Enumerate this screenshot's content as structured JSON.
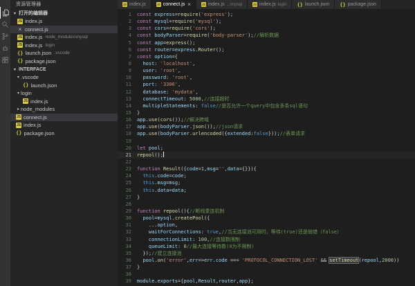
{
  "tab_close_glyph": "×",
  "activity_bar": [
    {
      "name": "explorer",
      "icon": "files",
      "active": true
    },
    {
      "name": "search",
      "icon": "search",
      "active": false
    },
    {
      "name": "source-control",
      "icon": "git",
      "active": false
    },
    {
      "name": "debug",
      "icon": "debug",
      "active": false
    },
    {
      "name": "extensions",
      "icon": "extensions",
      "active": false
    }
  ],
  "sidebar": {
    "title": "资源管理器",
    "open_editors": {
      "header": "打开的编辑器",
      "items": [
        {
          "label": "index.js",
          "icon": "js"
        },
        {
          "label": "connect.js",
          "icon": "close",
          "active": true
        },
        {
          "label": "index.js",
          "icon": "js",
          "desc": "node_modules\\mysql"
        },
        {
          "label": "index.js",
          "icon": "js",
          "desc": "login"
        },
        {
          "label": "launch.json",
          "icon": "json",
          "desc": ".vscode"
        },
        {
          "label": "package.json",
          "icon": "json"
        }
      ]
    },
    "tree": {
      "header": "INTERFACE",
      "items": [
        {
          "label": ".vscode",
          "icon": "none",
          "chevron": "down",
          "indent": 0
        },
        {
          "label": "launch.json",
          "icon": "json",
          "indent": 1
        },
        {
          "label": "login",
          "icon": "none",
          "chevron": "down",
          "indent": 0
        },
        {
          "label": "index.js",
          "icon": "js",
          "indent": 1
        },
        {
          "label": "node_modules",
          "icon": "none",
          "chevron": "right",
          "indent": 0
        },
        {
          "label": "connect.js",
          "icon": "js",
          "indent": 0,
          "active": true
        },
        {
          "label": "index.js",
          "icon": "js",
          "indent": 0
        },
        {
          "label": "package.json",
          "icon": "json",
          "indent": 0
        }
      ]
    }
  },
  "tabs": [
    {
      "label": "index.js",
      "icon": "js"
    },
    {
      "label": "connect.js",
      "icon": "js",
      "active": true
    },
    {
      "label": "index.js",
      "icon": "js",
      "desc": "...\\mysql"
    },
    {
      "label": "index.js",
      "icon": "js",
      "desc": "login"
    },
    {
      "label": "launch.json",
      "icon": "json"
    },
    {
      "label": "package.json",
      "icon": "json"
    }
  ],
  "editor": {
    "cursor_line": 21,
    "colors": {
      "background": "#1e1e1e",
      "keyword": "#c586c0",
      "keyword2": "#569cd6",
      "variable": "#9cdcfe",
      "function": "#dcdcaa",
      "string": "#ce9178",
      "number": "#b5cea8",
      "comment": "#6a9955",
      "default": "#d4d4d4"
    },
    "lines": [
      [
        [
          "k",
          "const "
        ],
        [
          "v",
          "express"
        ],
        [
          "w",
          "="
        ],
        [
          "f",
          "require"
        ],
        [
          "w",
          "("
        ],
        [
          "s",
          "'express'"
        ],
        [
          "w",
          ");"
        ]
      ],
      [
        [
          "k",
          "const "
        ],
        [
          "v",
          "mysql"
        ],
        [
          "w",
          "="
        ],
        [
          "f",
          "require"
        ],
        [
          "w",
          "("
        ],
        [
          "s",
          "'mysql'"
        ],
        [
          "w",
          ");"
        ]
      ],
      [
        [
          "k",
          "const "
        ],
        [
          "v",
          "cors"
        ],
        [
          "w",
          "="
        ],
        [
          "f",
          "require"
        ],
        [
          "w",
          "("
        ],
        [
          "s",
          "'cors'"
        ],
        [
          "w",
          ");"
        ]
      ],
      [
        [
          "k",
          "const "
        ],
        [
          "v",
          "bodyParser"
        ],
        [
          "w",
          "="
        ],
        [
          "f",
          "require"
        ],
        [
          "w",
          "("
        ],
        [
          "s",
          "'body-parser'"
        ],
        [
          "w",
          ");"
        ],
        [
          "c",
          "//解析数据"
        ]
      ],
      [
        [
          "k",
          "const "
        ],
        [
          "v",
          "app"
        ],
        [
          "w",
          "="
        ],
        [
          "f",
          "express"
        ],
        [
          "w",
          "();"
        ]
      ],
      [
        [
          "k",
          "const "
        ],
        [
          "v",
          "router"
        ],
        [
          "w",
          "="
        ],
        [
          "v",
          "express"
        ],
        [
          "w",
          "."
        ],
        [
          "f",
          "Router"
        ],
        [
          "w",
          "();"
        ]
      ],
      [
        [
          "k",
          "const "
        ],
        [
          "v",
          "option"
        ],
        [
          "w",
          "={"
        ]
      ],
      [
        [
          "w",
          "  "
        ],
        [
          "v",
          "host"
        ],
        [
          "w",
          ": "
        ],
        [
          "s",
          "'localhost'"
        ],
        [
          "w",
          ","
        ]
      ],
      [
        [
          "w",
          "  "
        ],
        [
          "v",
          "user"
        ],
        [
          "w",
          ": "
        ],
        [
          "s",
          "'root'"
        ],
        [
          "w",
          ","
        ]
      ],
      [
        [
          "w",
          "  "
        ],
        [
          "v",
          "password"
        ],
        [
          "w",
          ": "
        ],
        [
          "s",
          "'root'"
        ],
        [
          "w",
          ","
        ]
      ],
      [
        [
          "w",
          "  "
        ],
        [
          "v",
          "port"
        ],
        [
          "w",
          ": "
        ],
        [
          "s",
          "'3306'"
        ],
        [
          "w",
          ","
        ]
      ],
      [
        [
          "w",
          "  "
        ],
        [
          "v",
          "database"
        ],
        [
          "w",
          ": "
        ],
        [
          "s",
          "'mydata'"
        ],
        [
          "w",
          ","
        ]
      ],
      [
        [
          "w",
          "  "
        ],
        [
          "v",
          "connectTimeout"
        ],
        [
          "w",
          ": "
        ],
        [
          "n",
          "5000"
        ],
        [
          "w",
          ","
        ],
        [
          "c",
          "//连接超时"
        ]
      ],
      [
        [
          "w",
          "  "
        ],
        [
          "v",
          "multipleStatements"
        ],
        [
          "w",
          ": "
        ],
        [
          "b",
          "false"
        ],
        [
          "c",
          "//是否允许一个query中包含多条sql语句"
        ]
      ],
      [
        [
          "w",
          "}"
        ]
      ],
      [
        [
          "v",
          "app"
        ],
        [
          "w",
          "."
        ],
        [
          "f",
          "use"
        ],
        [
          "w",
          "("
        ],
        [
          "f",
          "cors"
        ],
        [
          "w",
          "());"
        ],
        [
          "c",
          "//解决跨域"
        ]
      ],
      [
        [
          "v",
          "app"
        ],
        [
          "w",
          "."
        ],
        [
          "f",
          "use"
        ],
        [
          "w",
          "("
        ],
        [
          "v",
          "bodyParser"
        ],
        [
          "w",
          "."
        ],
        [
          "f",
          "json"
        ],
        [
          "w",
          "());"
        ],
        [
          "c",
          "//json请求"
        ]
      ],
      [
        [
          "v",
          "app"
        ],
        [
          "w",
          "."
        ],
        [
          "f",
          "use"
        ],
        [
          "w",
          "("
        ],
        [
          "v",
          "bodyParser"
        ],
        [
          "w",
          "."
        ],
        [
          "f",
          "urlencoded"
        ],
        [
          "w",
          "({"
        ],
        [
          "v",
          "extended"
        ],
        [
          "w",
          ":"
        ],
        [
          "b",
          "false"
        ],
        [
          "w",
          "}));"
        ],
        [
          "c",
          "//表单请求"
        ]
      ],
      [],
      [
        [
          "k",
          "let "
        ],
        [
          "v",
          "pool"
        ],
        [
          "w",
          ";"
        ]
      ],
      [
        [
          "f",
          "repool"
        ],
        [
          "w",
          "();"
        ]
      ],
      [],
      [
        [
          "k",
          "function "
        ],
        [
          "f",
          "Result"
        ],
        [
          "w",
          "({"
        ],
        [
          "v",
          "code"
        ],
        [
          "w",
          "="
        ],
        [
          "n",
          "1"
        ],
        [
          "w",
          ","
        ],
        [
          "v",
          "msg"
        ],
        [
          "w",
          "="
        ],
        [
          "s",
          "''"
        ],
        [
          "w",
          ","
        ],
        [
          "v",
          "data"
        ],
        [
          "w",
          "={}}){"
        ]
      ],
      [
        [
          "w",
          "  "
        ],
        [
          "b",
          "this"
        ],
        [
          "w",
          "."
        ],
        [
          "v",
          "code"
        ],
        [
          "w",
          "="
        ],
        [
          "v",
          "code"
        ],
        [
          "w",
          ";"
        ]
      ],
      [
        [
          "w",
          "  "
        ],
        [
          "b",
          "this"
        ],
        [
          "w",
          "."
        ],
        [
          "v",
          "msg"
        ],
        [
          "w",
          "="
        ],
        [
          "v",
          "msg"
        ],
        [
          "w",
          ";"
        ]
      ],
      [
        [
          "w",
          "  "
        ],
        [
          "b",
          "this"
        ],
        [
          "w",
          "."
        ],
        [
          "v",
          "data"
        ],
        [
          "w",
          "="
        ],
        [
          "v",
          "data"
        ],
        [
          "w",
          ";"
        ]
      ],
      [
        [
          "w",
          "}"
        ]
      ],
      [],
      [
        [
          "k",
          "function "
        ],
        [
          "f",
          "repool"
        ],
        [
          "w",
          "(){"
        ],
        [
          "c",
          "//断线重连机制"
        ]
      ],
      [
        [
          "w",
          "  "
        ],
        [
          "v",
          "pool"
        ],
        [
          "w",
          "="
        ],
        [
          "v",
          "mysql"
        ],
        [
          "w",
          "."
        ],
        [
          "f",
          "createPool"
        ],
        [
          "w",
          "({"
        ]
      ],
      [
        [
          "w",
          "    ..."
        ],
        [
          "v",
          "option"
        ],
        [
          "w",
          ","
        ]
      ],
      [
        [
          "w",
          "    "
        ],
        [
          "v",
          "waitForConnections"
        ],
        [
          "w",
          ": "
        ],
        [
          "b",
          "true"
        ],
        [
          "w",
          ","
        ],
        [
          "c",
          "//当无连接池可用时，等待(true)还是抛错（false）"
        ]
      ],
      [
        [
          "w",
          "    "
        ],
        [
          "v",
          "connectionLimit"
        ],
        [
          "w",
          ": "
        ],
        [
          "n",
          "100"
        ],
        [
          "w",
          ","
        ],
        [
          "c",
          "//连接数限制"
        ]
      ],
      [
        [
          "w",
          "    "
        ],
        [
          "v",
          "queueLimit"
        ],
        [
          "w",
          ": "
        ],
        [
          "n",
          "0"
        ],
        [
          "c",
          "//最大连接等待数(0为不限制)"
        ]
      ],
      [
        [
          "w",
          "  });"
        ],
        [
          "c",
          "//建立连接池"
        ]
      ],
      [
        [
          "w",
          "  "
        ],
        [
          "v",
          "pool"
        ],
        [
          "w",
          "."
        ],
        [
          "f",
          "on"
        ],
        [
          "w",
          "("
        ],
        [
          "s",
          "'error'"
        ],
        [
          "w",
          ","
        ],
        [
          "v",
          "err"
        ],
        [
          "w",
          "=>"
        ],
        [
          "v",
          "err"
        ],
        [
          "w",
          "."
        ],
        [
          "v",
          "code"
        ],
        [
          "w",
          " === "
        ],
        [
          "s",
          "'PROTOCOL_CONNECTION_LOST'"
        ],
        [
          "w",
          " && "
        ],
        [
          "f hl",
          "setTimeout"
        ],
        [
          "w",
          "("
        ],
        [
          "v",
          "repool"
        ],
        [
          "w",
          ","
        ],
        [
          "n",
          "2000"
        ],
        [
          "w",
          "))"
        ]
      ],
      [
        [
          "w",
          "}"
        ]
      ],
      [],
      [
        [
          "v",
          "module"
        ],
        [
          "w",
          "."
        ],
        [
          "v",
          "exports"
        ],
        [
          "w",
          "={"
        ],
        [
          "v",
          "pool"
        ],
        [
          "w",
          ","
        ],
        [
          "v",
          "Result"
        ],
        [
          "w",
          ","
        ],
        [
          "v",
          "router"
        ],
        [
          "w",
          ","
        ],
        [
          "v",
          "app"
        ],
        [
          "w",
          "};"
        ]
      ]
    ]
  }
}
